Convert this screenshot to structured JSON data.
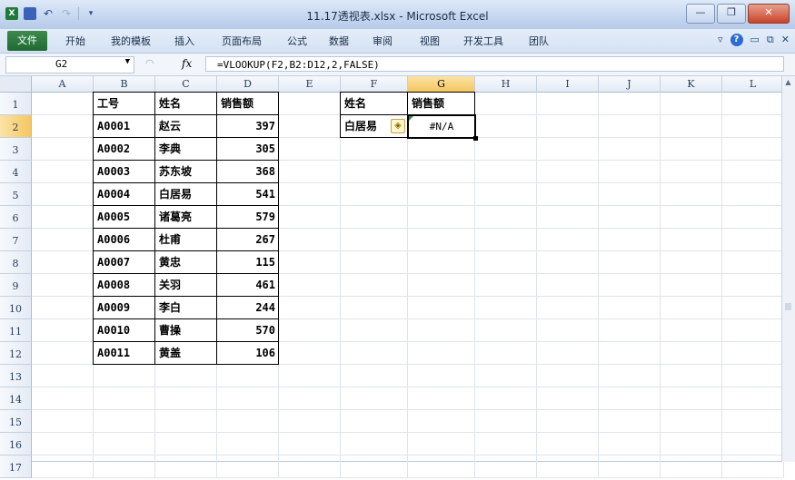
{
  "window": {
    "title": "11.17透视表.xlsx - Microsoft Excel",
    "controls": [
      "minimize",
      "restore",
      "close"
    ]
  },
  "ribbon": {
    "file_tab": "文件",
    "tabs": [
      "开始",
      "我的模板",
      "插入",
      "页面布局",
      "公式",
      "数据",
      "审阅",
      "视图",
      "开发工具",
      "团队"
    ]
  },
  "formula_bar": {
    "name_box": "G2",
    "fx": "fx",
    "formula": "=VLOOKUP(F2,B2:D12,2,FALSE)"
  },
  "sheet": {
    "columns": [
      "A",
      "B",
      "C",
      "D",
      "E",
      "F",
      "G",
      "H",
      "I",
      "J",
      "K",
      "L"
    ],
    "rows": [
      "1",
      "2",
      "3",
      "4",
      "5",
      "6",
      "7",
      "8",
      "9",
      "10",
      "11",
      "12",
      "13",
      "14",
      "15",
      "16",
      "17"
    ],
    "selected_column": "G",
    "selected_row": "2",
    "table_headers": [
      "工号",
      "姓名",
      "销售额"
    ],
    "table_rows": [
      [
        "A0001",
        "赵云",
        "397"
      ],
      [
        "A0002",
        "李典",
        "305"
      ],
      [
        "A0003",
        "苏东坡",
        "368"
      ],
      [
        "A0004",
        "白居易",
        "541"
      ],
      [
        "A0005",
        "诸葛亮",
        "579"
      ],
      [
        "A0006",
        "杜甫",
        "267"
      ],
      [
        "A0007",
        "黄忠",
        "115"
      ],
      [
        "A0008",
        "关羽",
        "461"
      ],
      [
        "A0009",
        "李白",
        "244"
      ],
      [
        "A0010",
        "曹操",
        "570"
      ],
      [
        "A0011",
        "黄盖",
        "106"
      ]
    ],
    "lookup_headers": [
      "姓名",
      "销售额"
    ],
    "lookup_name": "白居易",
    "lookup_result": "#N/A"
  }
}
